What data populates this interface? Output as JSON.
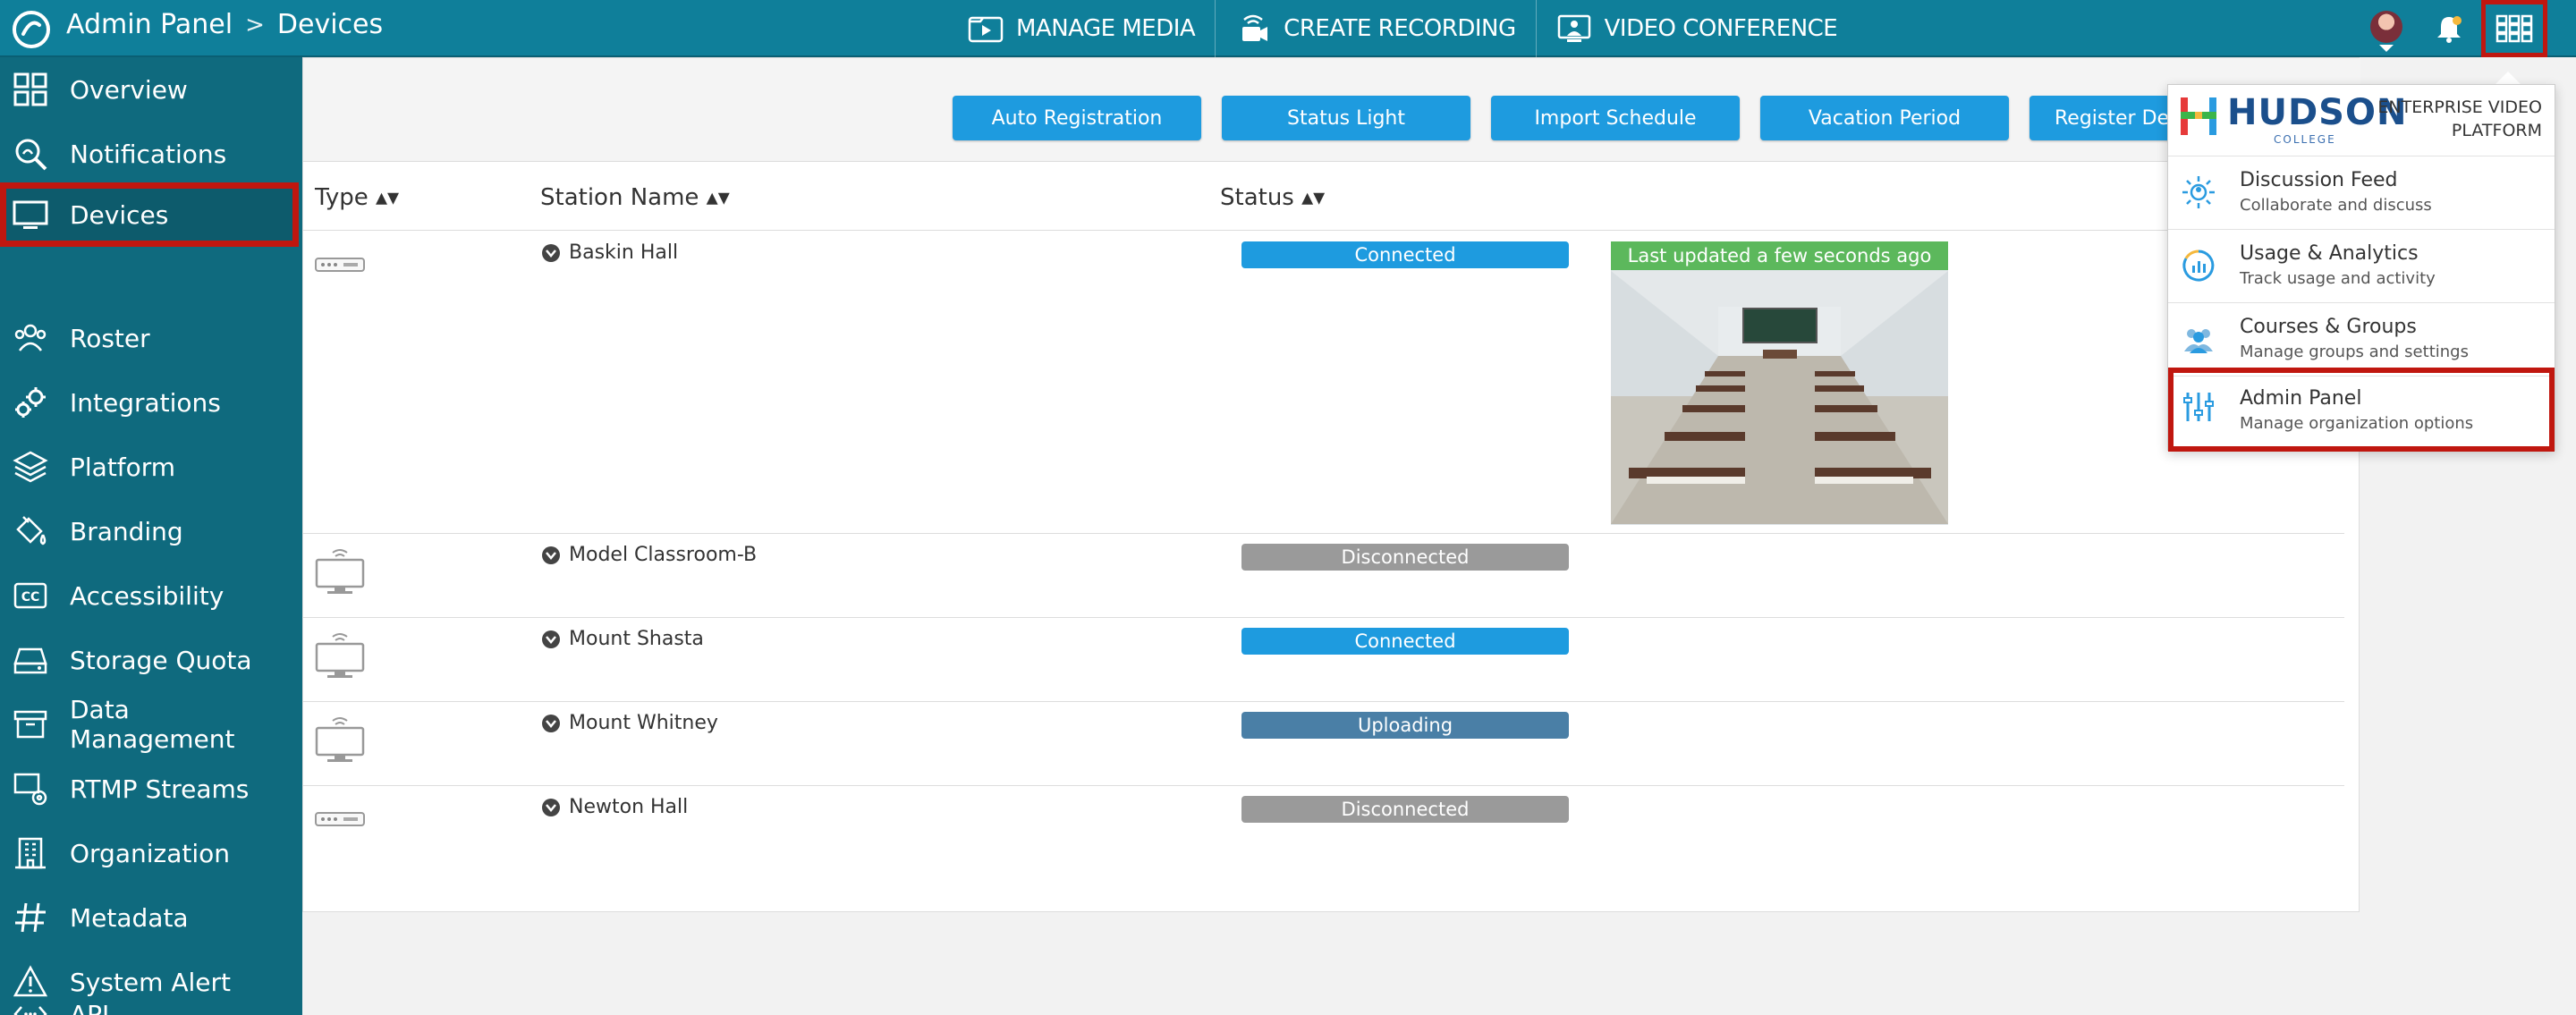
{
  "header": {
    "breadcrumb": [
      "Admin Panel",
      "Devices"
    ],
    "breadcrumb_separator": ">",
    "nav": [
      {
        "label": "MANAGE MEDIA",
        "icon": "media-folder-icon"
      },
      {
        "label": "CREATE RECORDING",
        "icon": "camera-icon"
      },
      {
        "label": "VIDEO CONFERENCE",
        "icon": "video-conference-icon"
      }
    ],
    "icons": [
      "avatar",
      "bell-icon",
      "apps-grid-icon"
    ]
  },
  "sidebar": {
    "items": [
      {
        "label": "Overview",
        "icon": "grid-icon"
      },
      {
        "label": "Notifications",
        "icon": "magnifier-icon"
      },
      {
        "label": "Devices",
        "icon": "monitor-icon",
        "active": true
      },
      {
        "label": "Roster",
        "icon": "people-icon"
      },
      {
        "label": "Integrations",
        "icon": "gears-icon"
      },
      {
        "label": "Platform",
        "icon": "layers-icon"
      },
      {
        "label": "Branding",
        "icon": "paint-bucket-icon"
      },
      {
        "label": "Accessibility",
        "icon": "cc-icon"
      },
      {
        "label": "Storage Quota",
        "icon": "drive-icon"
      },
      {
        "label": "Data Management",
        "icon": "archive-icon"
      },
      {
        "label": "RTMP Streams",
        "icon": "stream-icon"
      },
      {
        "label": "Organization",
        "icon": "building-icon"
      },
      {
        "label": "Metadata",
        "icon": "hash-icon"
      },
      {
        "label": "System Alert",
        "icon": "warning-icon"
      },
      {
        "label": "API",
        "icon": "code-icon"
      }
    ]
  },
  "toolbar": {
    "buttons": [
      "Auto Registration",
      "Status Light",
      "Import Schedule",
      "Vacation Period",
      "Register Devi"
    ]
  },
  "table": {
    "columns": [
      "Type ▴▾",
      "Station Name ▴▾",
      "Status ▴▾"
    ],
    "rows": [
      {
        "type": "encoder",
        "name": "Baskin Hall",
        "status": "Connected",
        "status_kind": "connected"
      },
      {
        "type": "monitor",
        "name": "Model Classroom-B",
        "status": "Disconnected",
        "status_kind": "disconnected"
      },
      {
        "type": "monitor",
        "name": "Mount Shasta",
        "status": "Connected",
        "status_kind": "connected"
      },
      {
        "type": "monitor",
        "name": "Mount Whitney",
        "status": "Uploading",
        "status_kind": "uploading"
      },
      {
        "type": "encoder",
        "name": "Newton Hall",
        "status": "Disconnected",
        "status_kind": "disconnected"
      }
    ],
    "preview_banner": "Last updated a few seconds ago"
  },
  "apps_menu": {
    "brand": "HUDSON",
    "brand_sub": "COLLEGE",
    "platform_line1": "ENTERPRISE VIDEO",
    "platform_line2": "PLATFORM",
    "items": [
      {
        "title": "Discussion Feed",
        "desc": "Collaborate and discuss",
        "icon": "discussion-icon"
      },
      {
        "title": "Usage & Analytics",
        "desc": "Track usage and activity",
        "icon": "analytics-icon"
      },
      {
        "title": "Courses & Groups",
        "desc": "Manage groups and settings",
        "icon": "groups-icon"
      },
      {
        "title": "Admin Panel",
        "desc": "Manage organization options",
        "icon": "admin-sliders-icon",
        "active": true
      }
    ]
  },
  "colors": {
    "topbar": "#0f7f9a",
    "sidebar": "#0f6a7e",
    "accent_button": "#1e9bdf",
    "highlight": "#c0170f",
    "connected": "#1e9bdf",
    "disconnected": "#9a9a9a",
    "uploading": "#4a7fa6",
    "banner": "#5cb85c"
  }
}
